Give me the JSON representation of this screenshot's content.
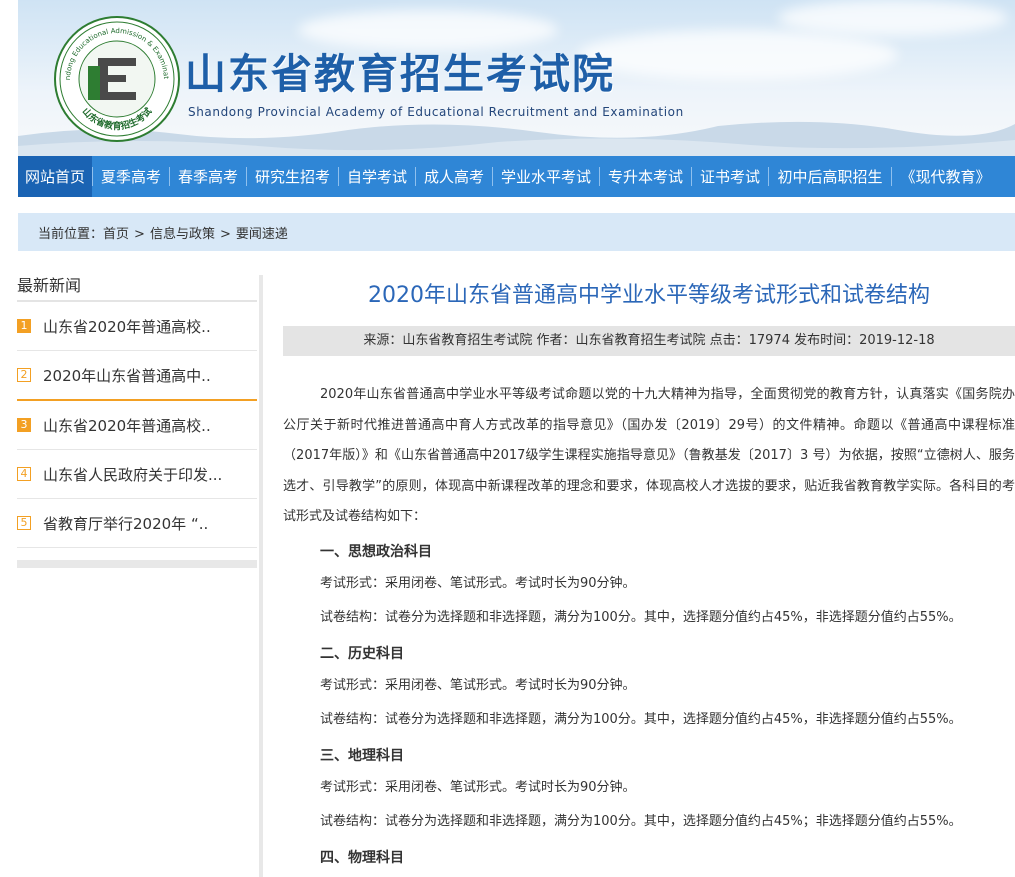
{
  "header": {
    "title": "山东省教育招生考试院",
    "subtitle": "Shandong Provincial Academy of Educational Recruitment and Examination",
    "seal_text_en": "Shandong Educational Admission & Examinations",
    "seal_text_zh": "山东省教育招生考试"
  },
  "colors": {
    "nav": "#2f86d6",
    "nav_active": "#1a63b3",
    "accent": "#f3a023",
    "title": "#2b67b8"
  },
  "nav": {
    "items": [
      {
        "label": "网站首页"
      },
      {
        "label": "夏季高考"
      },
      {
        "label": "春季高考"
      },
      {
        "label": "研究生招考"
      },
      {
        "label": "自学考试"
      },
      {
        "label": "成人高考"
      },
      {
        "label": "学业水平考试"
      },
      {
        "label": "专升本考试"
      },
      {
        "label": "证书考试"
      },
      {
        "label": "初中后高职招生"
      },
      {
        "label": "《现代教育》"
      }
    ]
  },
  "breadcrumb": {
    "prefix": "当前位置：",
    "items": [
      "首页",
      "信息与政策",
      "要闻速递"
    ],
    "separator": ">"
  },
  "sidebar": {
    "title": "最新新闻",
    "items": [
      {
        "num": "1",
        "text": "山东省2020年普通高校.."
      },
      {
        "num": "2",
        "text": "2020年山东省普通高中.."
      },
      {
        "num": "3",
        "text": "山东省2020年普通高校.."
      },
      {
        "num": "4",
        "text": "山东省人民政府关于印发..."
      },
      {
        "num": "5",
        "text": "省教育厅举行2020年 “.."
      }
    ]
  },
  "article": {
    "title": "2020年山东省普通高中学业水平等级考试形式和试卷结构",
    "meta": "来源：山东省教育招生考试院 作者：山东省教育招生考试院 点击：17974 发布时间：2019-12-18",
    "intro": "2020年山东省普通高中学业水平等级考试命题以党的十九大精神为指导，全面贯彻党的教育方针，认真落实《国务院办公厅关于新时代推进普通高中育人方式改革的指导意见》（国办发〔2019〕29号）的文件精神。命题以《普通高中课程标准（2017年版）》和《山东省普通高中2017级学生课程实施指导意见》（鲁教基发〔2017〕3 号）为依据，按照“立德树人、服务选才、引导教学”的原则，体现高中新课程改革的理念和要求，体现高校人才选拔的要求，贴近我省教育教学实际。各科目的考试形式及试卷结构如下：",
    "sections": [
      {
        "heading": "一、思想政治科目",
        "form": "考试形式：采用闭卷、笔试形式。考试时长为90分钟。",
        "structure": "试卷结构：试卷分为选择题和非选择题，满分为100分。其中，选择题分值约占45%，非选择题分值约占55%。"
      },
      {
        "heading": "二、历史科目",
        "form": "考试形式：采用闭卷、笔试形式。考试时长为90分钟。",
        "structure": "试卷结构：试卷分为选择题和非选择题，满分为100分。其中，选择题分值约占45%，非选择题分值约占55%。"
      },
      {
        "heading": "三、地理科目",
        "form": "考试形式：采用闭卷、笔试形式。考试时长为90分钟。",
        "structure": "试卷结构：试卷分为选择题和非选择题，满分为100分。其中，选择题分值约占45%；非选择题分值约占55%。"
      },
      {
        "heading": "四、物理科目"
      }
    ]
  }
}
